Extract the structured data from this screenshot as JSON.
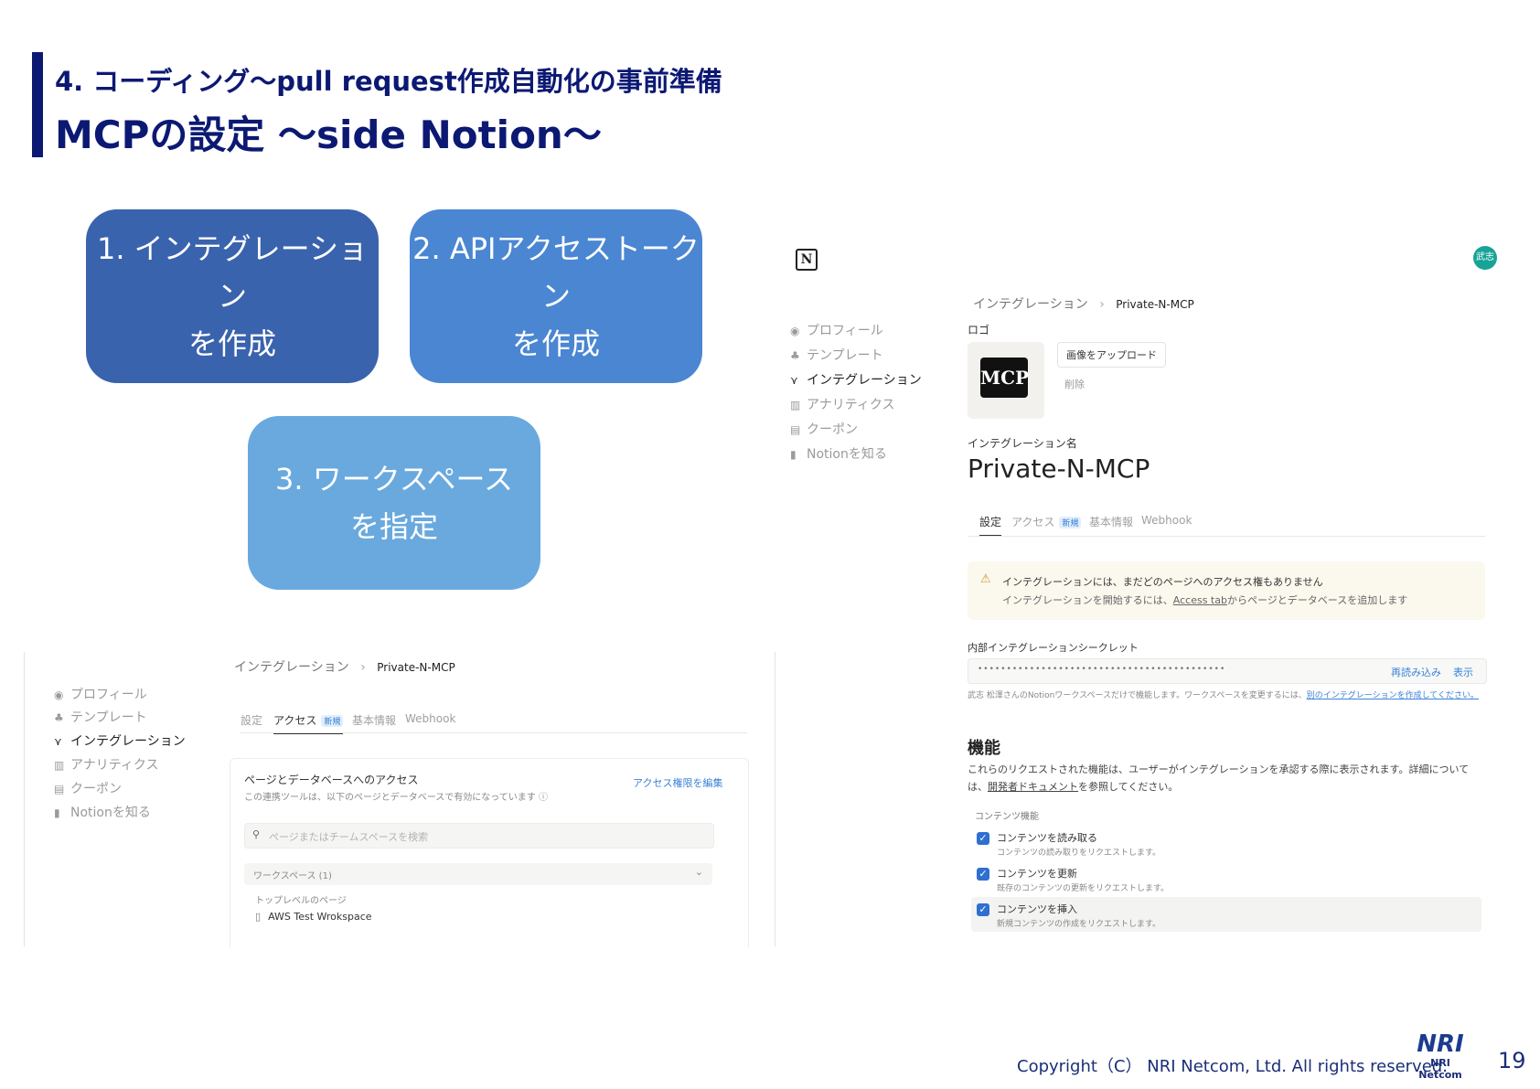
{
  "slide": {
    "subtitle": "4. コーディング～pull request作成自動化の事前準備",
    "title": "MCPの設定 ～side Notion～",
    "page_number": "19",
    "copyright": "Copyright（C） NRI Netcom, Ltd. All rights reserved.",
    "logo_text": "NRI",
    "logo_subtext": "NRI Netcom"
  },
  "steps": [
    {
      "line1": "1. インテグレーション",
      "line2": "を作成",
      "color": "#3a63ad"
    },
    {
      "line1": "2. APIアクセストークン",
      "line2": "を作成",
      "color": "#4a86d2"
    },
    {
      "line1": "3. ワークスペース",
      "line2": "を指定",
      "color": "#69a9de"
    }
  ],
  "left_screenshot": {
    "nav": [
      {
        "icon": "profile-icon",
        "label": "プロフィール"
      },
      {
        "icon": "template-icon",
        "label": "テンプレート"
      },
      {
        "icon": "integration-icon",
        "label": "インテグレーション",
        "active": true
      },
      {
        "icon": "analytics-icon",
        "label": "アナリティクス"
      },
      {
        "icon": "coupon-icon",
        "label": "クーポン"
      },
      {
        "icon": "book-icon",
        "label": "Notionを知る"
      }
    ],
    "breadcrumb": {
      "parent": "インテグレーション",
      "separator": "›",
      "current": "Private-N-MCP"
    },
    "tabs": [
      {
        "label": "設定"
      },
      {
        "label": "アクセス",
        "badge": "新規",
        "active": true
      },
      {
        "label": "基本情報"
      },
      {
        "label": "Webhook"
      }
    ],
    "access_heading": "ページとデータベースへのアクセス",
    "access_desc": "この連携ツールは、以下のページとデータベースで有効になっています",
    "edit_link": "アクセス権限を編集",
    "search_placeholder": "ページまたはチームスペースを検索",
    "workspace_label": "ワークスペース (1)",
    "toplevel_label": "トップレベルのページ",
    "page_item": "AWS Test Wrokspace"
  },
  "right_screenshot": {
    "avatar": "武志",
    "nav": [
      {
        "icon": "profile-icon",
        "label": "プロフィール"
      },
      {
        "icon": "template-icon",
        "label": "テンプレート"
      },
      {
        "icon": "integration-icon",
        "label": "インテグレーション",
        "active": true
      },
      {
        "icon": "analytics-icon",
        "label": "アナリティクス"
      },
      {
        "icon": "coupon-icon",
        "label": "クーポン"
      },
      {
        "icon": "book-icon",
        "label": "Notionを知る"
      }
    ],
    "breadcrumb": {
      "parent": "インテグレーション",
      "separator": "›",
      "current": "Private-N-MCP"
    },
    "logo_label": "ロゴ",
    "logo_image_text": "MCP",
    "upload_button": "画像をアップロード",
    "delete_link": "削除",
    "name_label": "インテグレーション名",
    "name_value": "Private-N-MCP",
    "tabs": [
      {
        "label": "設定",
        "active": true
      },
      {
        "label": "アクセス",
        "badge": "新規"
      },
      {
        "label": "基本情報"
      },
      {
        "label": "Webhook"
      }
    ],
    "warning_line1": "インテグレーションには、まだどのページへのアクセス権もありません",
    "warning_line2_pre": "インテグレーションを開始するには、",
    "warning_link": "Access tab",
    "warning_line2_post": "からページとデータベースを追加します",
    "secret_label": "内部インテグレーションシークレット",
    "secret_mask": "•••••••••••••••••••••••••••••••••••••••••••",
    "reload_link": "再読み込み",
    "show_link": "表示",
    "secret_note_pre": "武志 松澤さんのNotionワークスペースだけで機能します。ワークスペースを変更するには、",
    "secret_note_link": "別のインテグレーションを作成してください。",
    "capabilities_heading": "機能",
    "capabilities_desc_pre": "これらのリクエストされた機能は、ユーザーがインテグレーションを承認する際に表示されます。詳細については、",
    "capabilities_desc_link": "開発者ドキュメント",
    "capabilities_desc_post": "を参照してください。",
    "content_caps_label": "コンテンツ機能",
    "capabilities": [
      {
        "label": "コンテンツを読み取る",
        "desc": "コンテンツの読み取りをリクエストします。",
        "checked": true
      },
      {
        "label": "コンテンツを更新",
        "desc": "既存のコンテンツの更新をリクエストします。",
        "checked": true
      },
      {
        "label": "コンテンツを挿入",
        "desc": "新規コンテンツの作成をリクエストします。",
        "checked": true
      }
    ]
  }
}
